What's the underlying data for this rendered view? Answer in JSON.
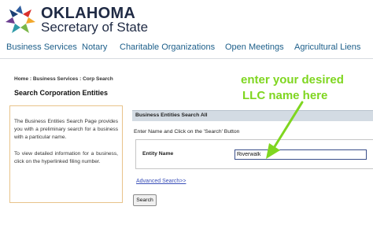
{
  "header": {
    "org_name": "OKLAHOMA",
    "org_sub": "Secretary of State",
    "logo_icon": "oklahoma-star-logo-icon"
  },
  "nav": {
    "items": [
      {
        "label": "Business Services"
      },
      {
        "label": "Notary"
      },
      {
        "label": "Charitable Organizations"
      },
      {
        "label": "Open Meetings"
      },
      {
        "label": "Agricultural Liens"
      }
    ]
  },
  "breadcrumb": "Home : Business Services : Corp Search",
  "page_title": "Search Corporation Entities",
  "info": {
    "paragraph1": "The Business Entities Search Page provides you with a preliminary search for a business with a particular name.",
    "paragraph2": "To view detailed information for a business, click on the hyperlinked filing number."
  },
  "search": {
    "panel_title": "Business Entities Search All",
    "instruction": "Enter Name and Click on the 'Search' Button",
    "entity_label": "Entity Name",
    "entity_value": "Riverwalk",
    "advanced_link": "Advanced Search>>",
    "search_button": "Search"
  },
  "annotation": {
    "line1": "enter your desired",
    "line2": "LLC name here",
    "color": "#7fd620"
  },
  "colors": {
    "nav_text": "#1d5f8a",
    "panel_header": "#d3dbe3",
    "info_border": "#e8c38a",
    "link": "#3a4fb8"
  }
}
